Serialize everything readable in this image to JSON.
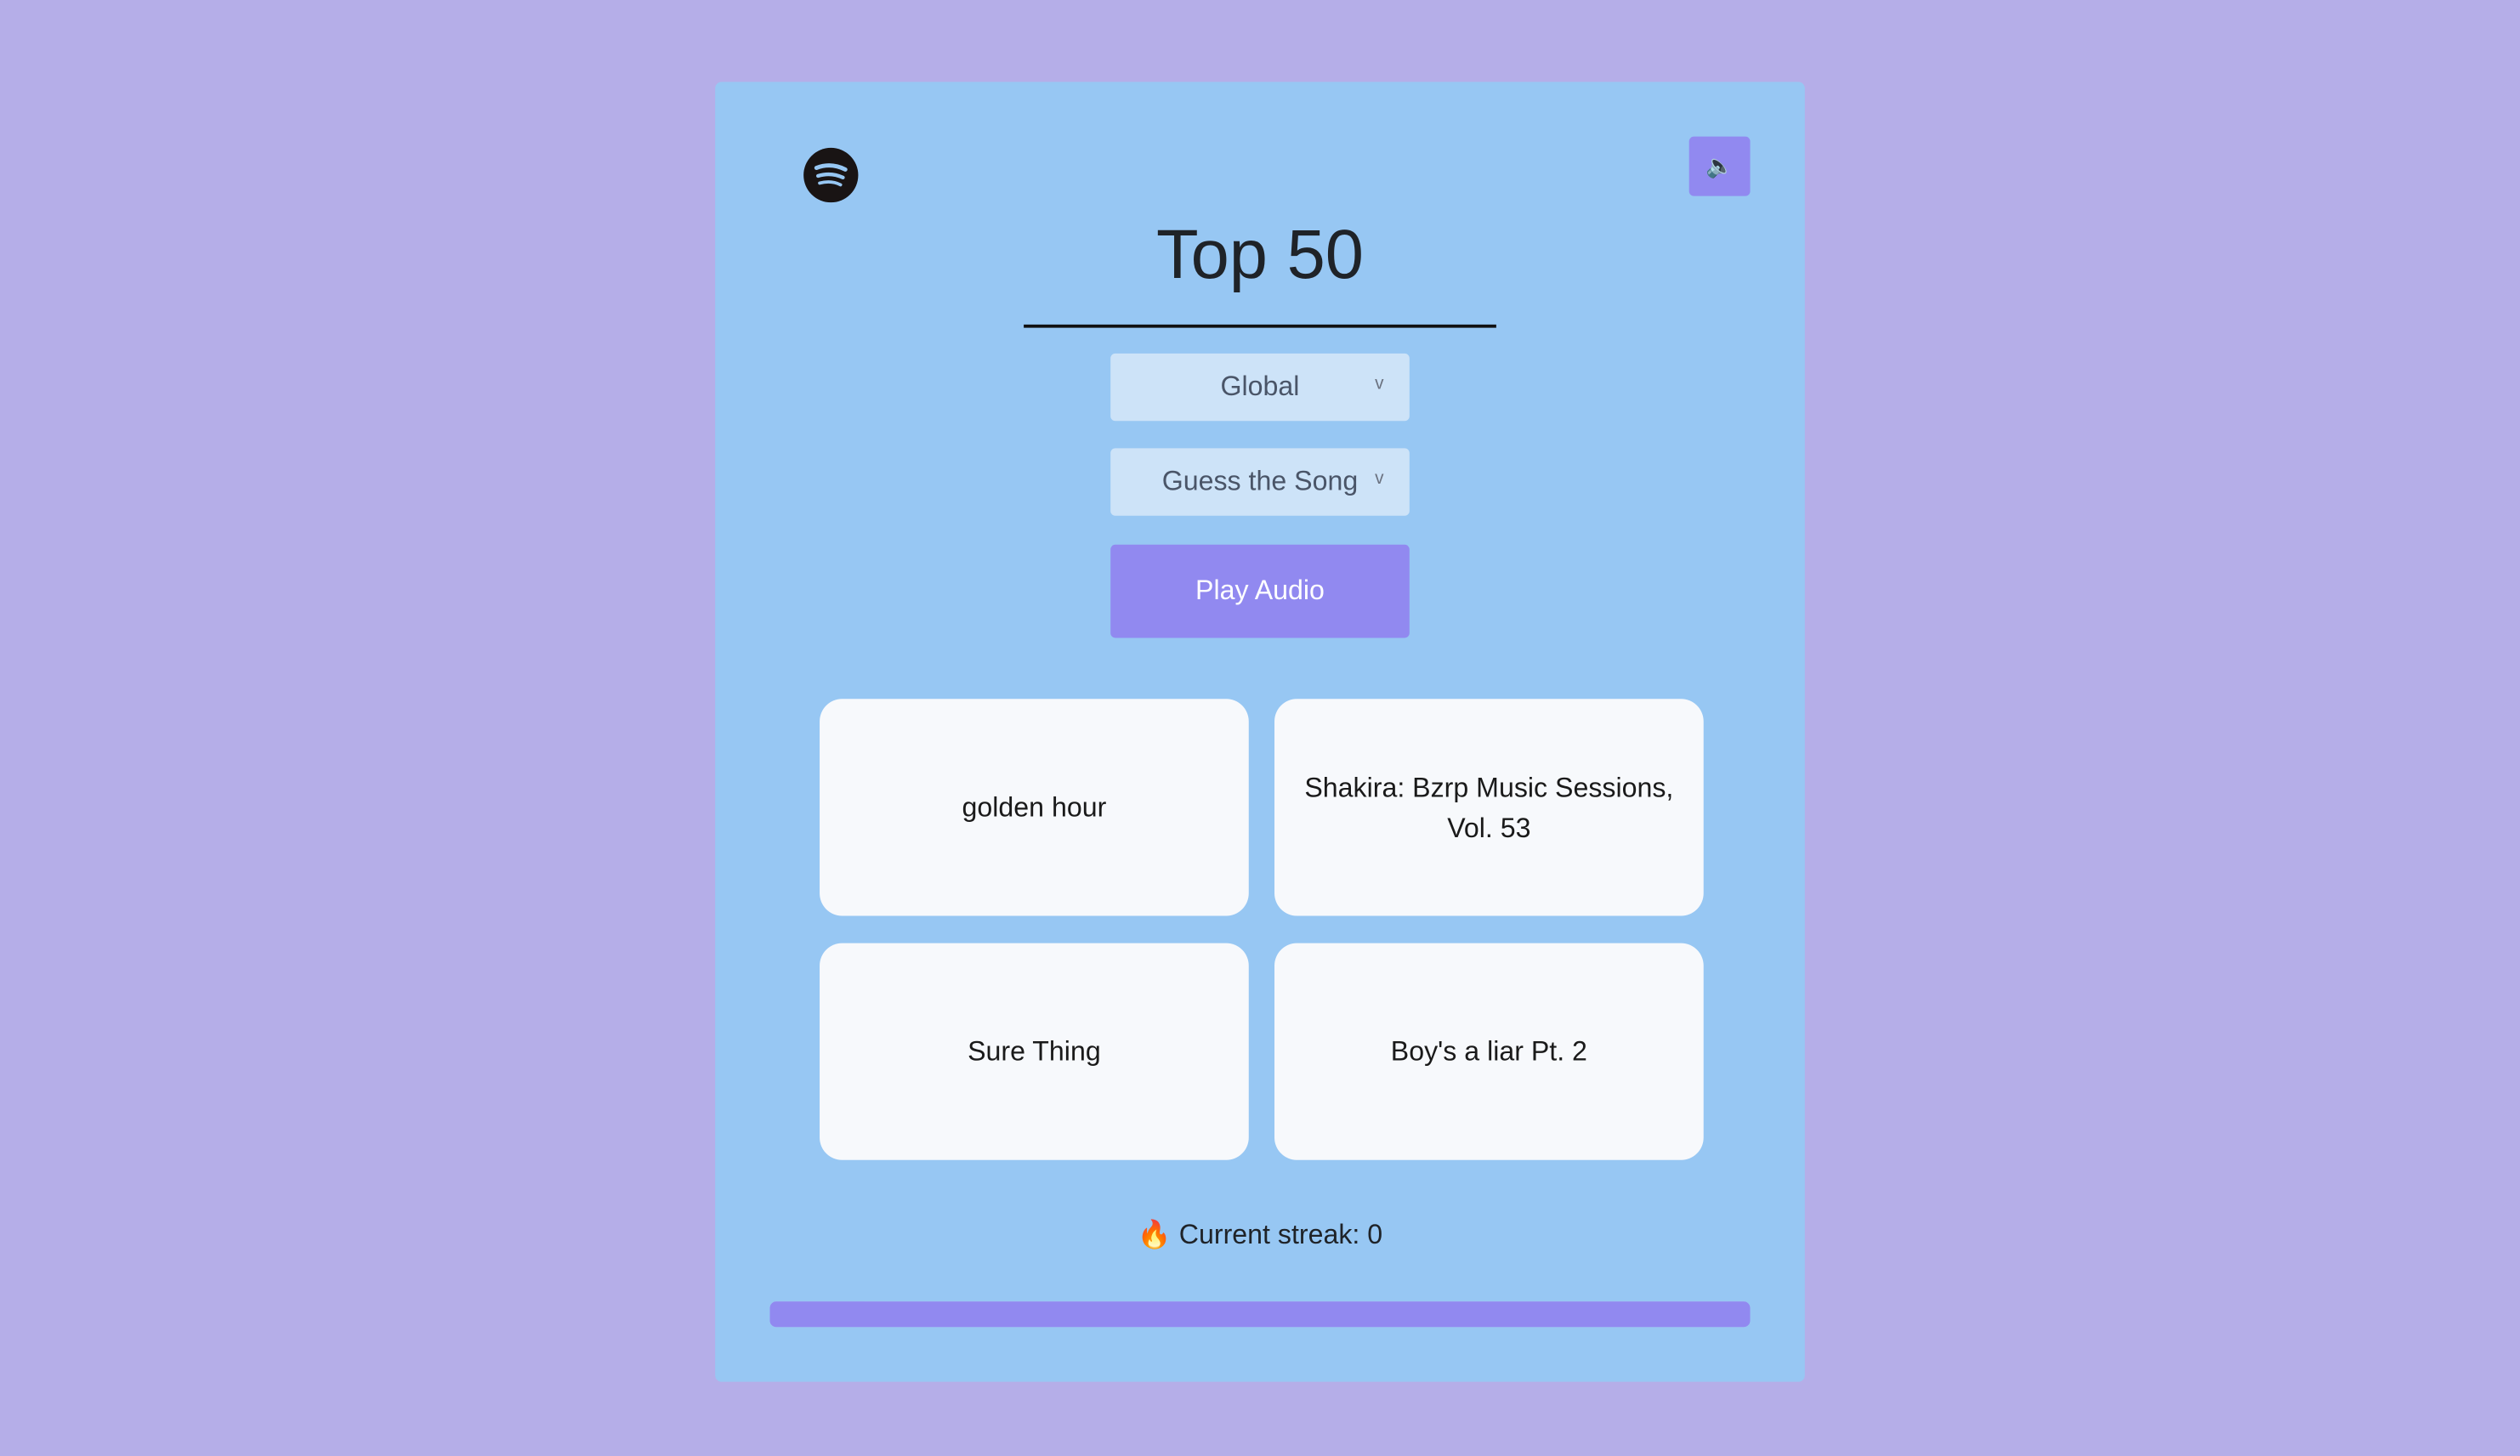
{
  "header": {
    "title": "Top 50",
    "sound_icon": "🔈"
  },
  "controls": {
    "region_select": "Global",
    "mode_select": "Guess the Song",
    "play_label": "Play Audio"
  },
  "options": [
    {
      "label": "golden hour"
    },
    {
      "label": "Shakira: Bzrp Music Sessions, Vol. 53"
    },
    {
      "label": "Sure Thing"
    },
    {
      "label": "Boy's a liar Pt. 2"
    }
  ],
  "streak": {
    "icon": "🔥",
    "label": "Current streak: 0"
  },
  "progress": {
    "percent": 100
  },
  "colors": {
    "background": "#b5aee8",
    "card": "#97c7f3",
    "accent": "#9189f0"
  }
}
